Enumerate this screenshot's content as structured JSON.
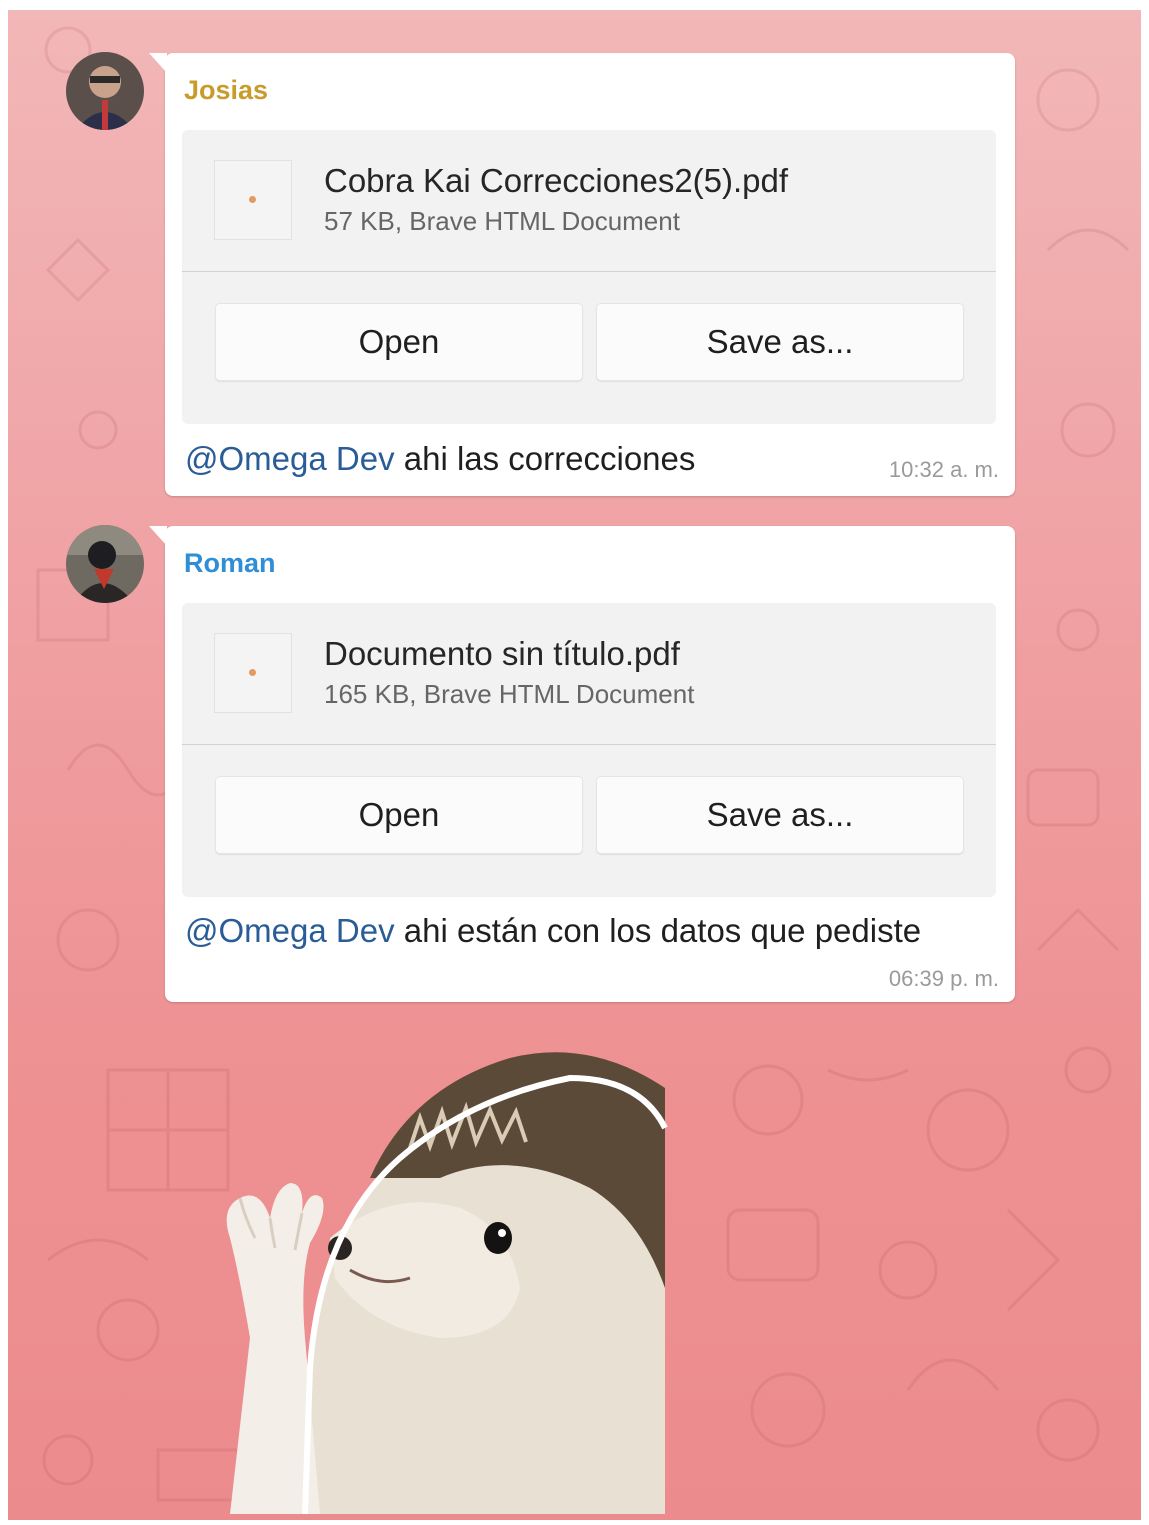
{
  "messages": [
    {
      "sender": "Josias",
      "sender_color": "#c89b2c",
      "file": {
        "name": "Cobra Kai Correcciones2(5).pdf",
        "info": "57 KB, Brave HTML Document"
      },
      "buttons": {
        "open": "Open",
        "save": "Save as..."
      },
      "mention": "@Omega Dev",
      "text": " ahi las correcciones",
      "time": "10:32 a. m."
    },
    {
      "sender": "Roman",
      "sender_color": "#2e8ed6",
      "file": {
        "name": "Documento sin título.pdf",
        "info": "165 KB, Brave HTML Document"
      },
      "buttons": {
        "open": "Open",
        "save": "Save as..."
      },
      "mention": "@Omega Dev",
      "text": " ahi están con los datos que pediste",
      "time": "06:39 p. m."
    }
  ],
  "sticker": {
    "icon": "hedgehog-waving-sticker"
  }
}
